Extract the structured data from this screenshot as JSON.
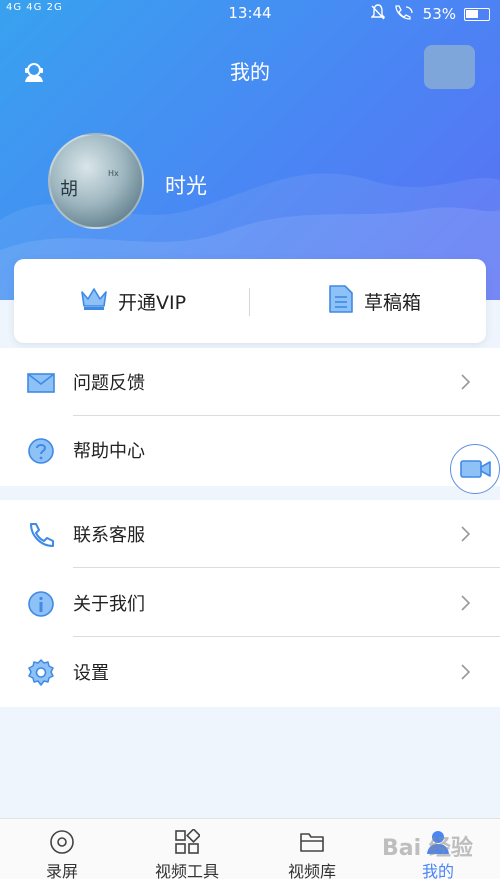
{
  "status_bar": {
    "left": "4G 4G 2G",
    "time": "13:44",
    "battery": "53%"
  },
  "header": {
    "title": "我的",
    "username": "时光",
    "avatar_chars": "胡",
    "avatar_small_text": "Hx"
  },
  "quick_card": {
    "vip_label": "开通VIP",
    "drafts_label": "草稿箱"
  },
  "menu": {
    "group1": [
      {
        "label": "问题反馈",
        "icon": "mail-icon"
      },
      {
        "label": "帮助中心",
        "icon": "question-icon"
      }
    ],
    "group2": [
      {
        "label": "联系客服",
        "icon": "phone-icon"
      },
      {
        "label": "关于我们",
        "icon": "info-icon"
      },
      {
        "label": "设置",
        "icon": "gear-icon"
      }
    ]
  },
  "tabs": [
    {
      "label": "录屏",
      "icon": "record-icon"
    },
    {
      "label": "视频工具",
      "icon": "tools-grid-icon"
    },
    {
      "label": "视频库",
      "icon": "folder-icon"
    },
    {
      "label": "我的",
      "icon": "profile-icon",
      "active": true
    }
  ],
  "watermark": "Bai 经验",
  "colors": {
    "accent": "#4a86f4",
    "header_start": "#38a2ef",
    "header_end": "#5a6ff3"
  }
}
